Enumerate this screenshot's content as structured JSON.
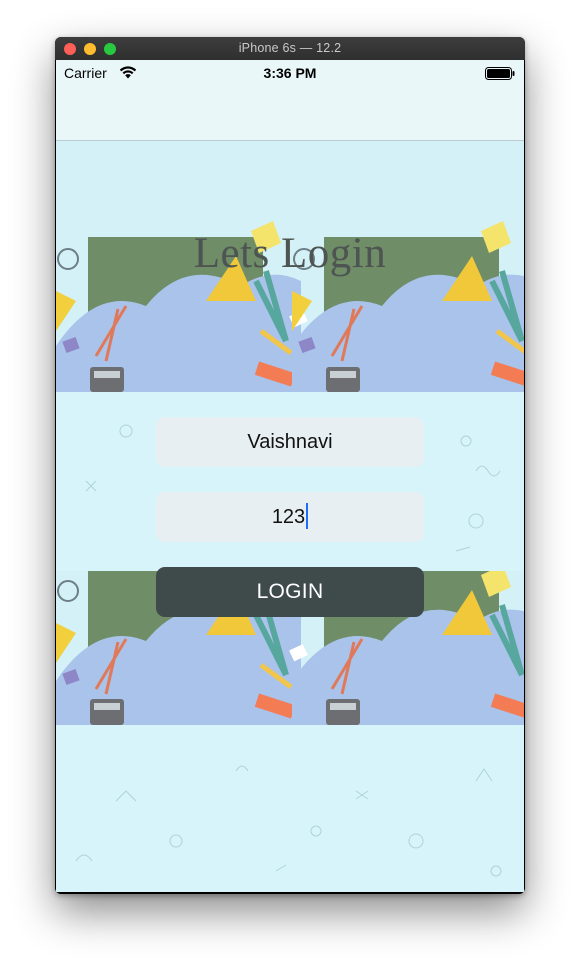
{
  "window": {
    "title": "iPhone 6s — 12.2"
  },
  "status_bar": {
    "carrier": "Carrier",
    "time": "3:36 PM"
  },
  "page": {
    "title": "Lets Login"
  },
  "form": {
    "username_value": "Vaishnavi",
    "password_value": "123",
    "login_label": "LOGIN"
  },
  "colors": {
    "background": "#d8f4fb",
    "nav_bar": "#eaf7f9",
    "field_background": "#e7eff2",
    "button_background": "#3f4a4b",
    "title_color": "#4d5452",
    "caret": "#1f6cff"
  }
}
